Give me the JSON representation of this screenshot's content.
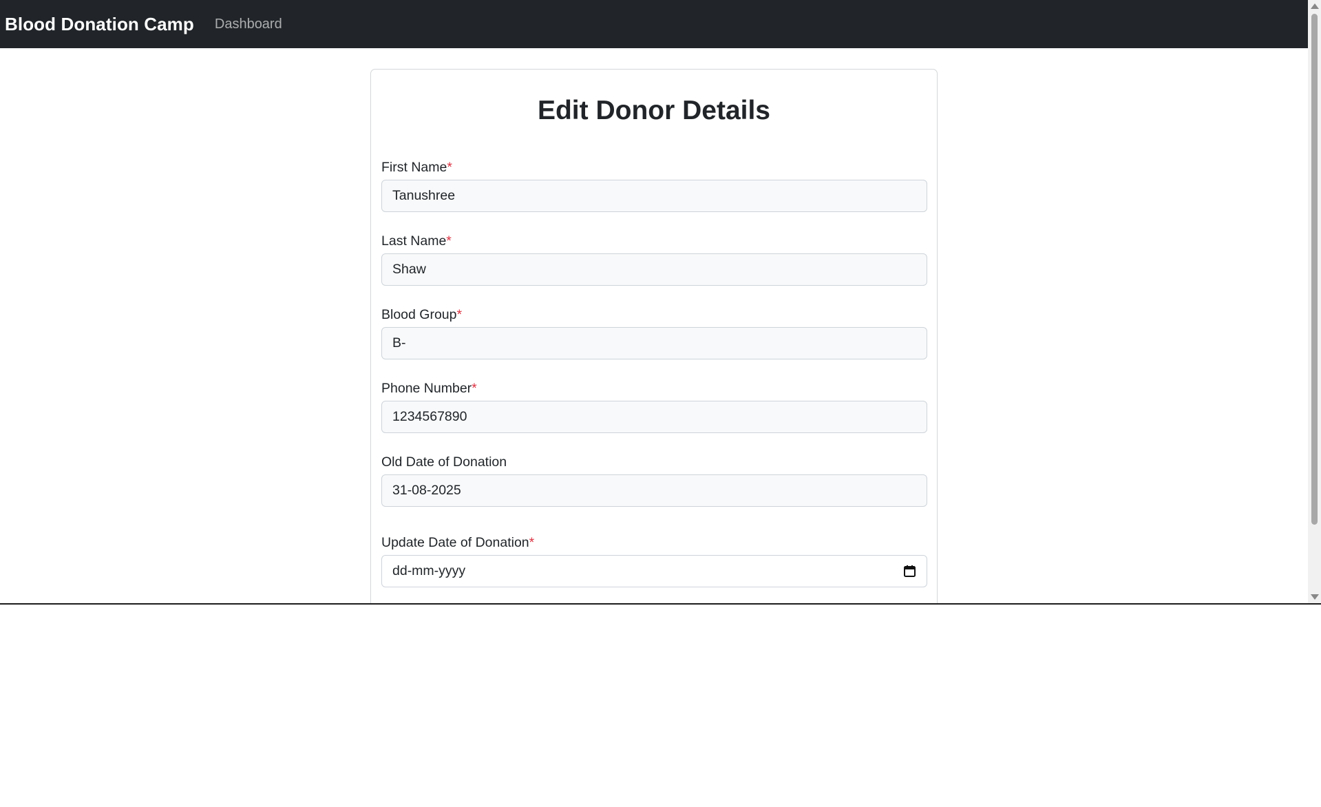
{
  "navbar": {
    "brand": "Blood Donation Camp",
    "links": [
      "Dashboard"
    ]
  },
  "form": {
    "title": "Edit Donor Details",
    "required_marker": "*",
    "fields": [
      {
        "label": "First Name",
        "value": "Tanushree",
        "required": true
      },
      {
        "label": "Last Name",
        "value": "Shaw",
        "required": true
      },
      {
        "label": "Blood Group",
        "value": "B-",
        "required": true
      },
      {
        "label": "Phone Number",
        "value": "1234567890",
        "required": true
      },
      {
        "label": "Old Date of Donation",
        "value": "31-08-2025",
        "required": false
      },
      {
        "label": "Update Date of Donation",
        "placeholder": "dd-mm-yyyy",
        "required": true,
        "icon": "calendar-icon"
      }
    ]
  },
  "colors": {
    "navbar_bg": "#212529",
    "required": "#dc3545",
    "input_bg": "#f8f9fa"
  }
}
